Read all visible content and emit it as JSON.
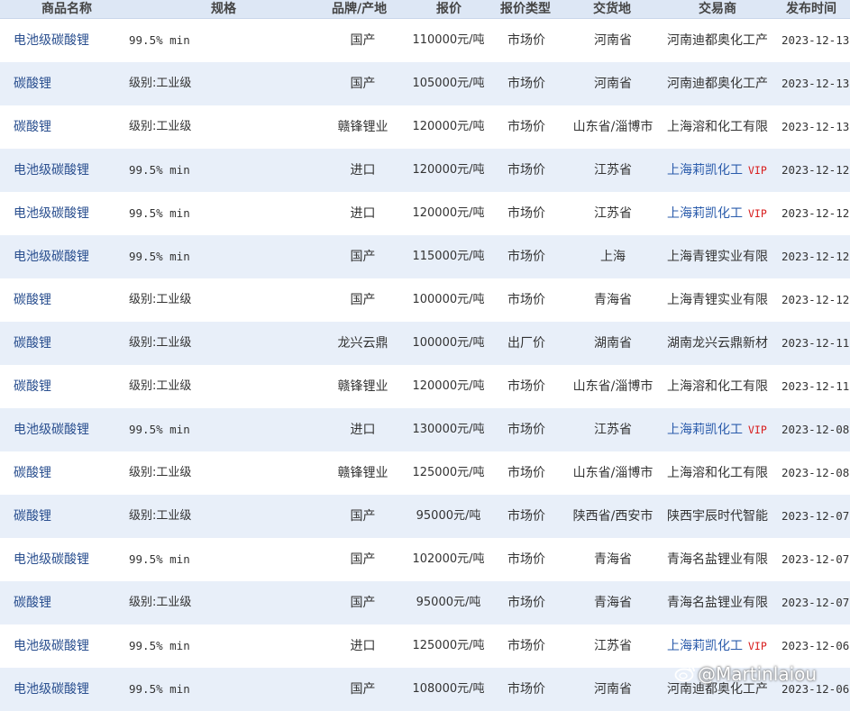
{
  "headers": {
    "name": "商品名称",
    "spec": "规格",
    "brand": "品牌/产地",
    "price": "报价",
    "price_type": "报价类型",
    "delivery": "交货地",
    "trader": "交易商",
    "date": "发布时间"
  },
  "vip_label": "VIP",
  "rows": [
    {
      "name": "电池级碳酸锂",
      "spec": "99.5% min",
      "brand": "国产",
      "price": "110000元/吨",
      "type": "市场价",
      "place": "河南省",
      "trader": "河南迪都奥化工产",
      "vip": false,
      "date": "2023-12-13"
    },
    {
      "name": "碳酸锂",
      "spec": "级别:工业级",
      "brand": "国产",
      "price": "105000元/吨",
      "type": "市场价",
      "place": "河南省",
      "trader": "河南迪都奥化工产",
      "vip": false,
      "date": "2023-12-13"
    },
    {
      "name": "碳酸锂",
      "spec": "级别:工业级",
      "brand": "赣锋锂业",
      "price": "120000元/吨",
      "type": "市场价",
      "place": "山东省/淄博市",
      "trader": "上海溶和化工有限",
      "vip": false,
      "date": "2023-12-13"
    },
    {
      "name": "电池级碳酸锂",
      "spec": "99.5% min",
      "brand": "进口",
      "price": "120000元/吨",
      "type": "市场价",
      "place": "江苏省",
      "trader": "上海莉凯化工",
      "vip": true,
      "date": "2023-12-12"
    },
    {
      "name": "电池级碳酸锂",
      "spec": "99.5% min",
      "brand": "进口",
      "price": "120000元/吨",
      "type": "市场价",
      "place": "江苏省",
      "trader": "上海莉凯化工",
      "vip": true,
      "date": "2023-12-12"
    },
    {
      "name": "电池级碳酸锂",
      "spec": "99.5% min",
      "brand": "国产",
      "price": "115000元/吨",
      "type": "市场价",
      "place": "上海",
      "trader": "上海青锂实业有限",
      "vip": false,
      "date": "2023-12-12"
    },
    {
      "name": "碳酸锂",
      "spec": "级别:工业级",
      "brand": "国产",
      "price": "100000元/吨",
      "type": "市场价",
      "place": "青海省",
      "trader": "上海青锂实业有限",
      "vip": false,
      "date": "2023-12-12"
    },
    {
      "name": "碳酸锂",
      "spec": "级别:工业级",
      "brand": "龙兴云鼎",
      "price": "100000元/吨",
      "type": "出厂价",
      "place": "湖南省",
      "trader": "湖南龙兴云鼎新材",
      "vip": false,
      "date": "2023-12-11"
    },
    {
      "name": "碳酸锂",
      "spec": "级别:工业级",
      "brand": "赣锋锂业",
      "price": "120000元/吨",
      "type": "市场价",
      "place": "山东省/淄博市",
      "trader": "上海溶和化工有限",
      "vip": false,
      "date": "2023-12-11"
    },
    {
      "name": "电池级碳酸锂",
      "spec": "99.5% min",
      "brand": "进口",
      "price": "130000元/吨",
      "type": "市场价",
      "place": "江苏省",
      "trader": "上海莉凯化工",
      "vip": true,
      "date": "2023-12-08"
    },
    {
      "name": "碳酸锂",
      "spec": "级别:工业级",
      "brand": "赣锋锂业",
      "price": "125000元/吨",
      "type": "市场价",
      "place": "山东省/淄博市",
      "trader": "上海溶和化工有限",
      "vip": false,
      "date": "2023-12-08"
    },
    {
      "name": "碳酸锂",
      "spec": "级别:工业级",
      "brand": "国产",
      "price": "95000元/吨",
      "type": "市场价",
      "place": "陕西省/西安市",
      "trader": "陕西宇辰时代智能",
      "vip": false,
      "date": "2023-12-07"
    },
    {
      "name": "电池级碳酸锂",
      "spec": "99.5% min",
      "brand": "国产",
      "price": "102000元/吨",
      "type": "市场价",
      "place": "青海省",
      "trader": "青海名盐锂业有限",
      "vip": false,
      "date": "2023-12-07"
    },
    {
      "name": "碳酸锂",
      "spec": "级别:工业级",
      "brand": "国产",
      "price": "95000元/吨",
      "type": "市场价",
      "place": "青海省",
      "trader": "青海名盐锂业有限",
      "vip": false,
      "date": "2023-12-07"
    },
    {
      "name": "电池级碳酸锂",
      "spec": "99.5% min",
      "brand": "进口",
      "price": "125000元/吨",
      "type": "市场价",
      "place": "江苏省",
      "trader": "上海莉凯化工",
      "vip": true,
      "date": "2023-12-06"
    },
    {
      "name": "电池级碳酸锂",
      "spec": "99.5% min",
      "brand": "国产",
      "price": "108000元/吨",
      "type": "市场价",
      "place": "河南省",
      "trader": "河南迪都奥化工产",
      "vip": false,
      "date": "2023-12-06"
    }
  ],
  "watermark": {
    "text": "@Martinlaiou",
    "icon": "weibo-icon"
  }
}
